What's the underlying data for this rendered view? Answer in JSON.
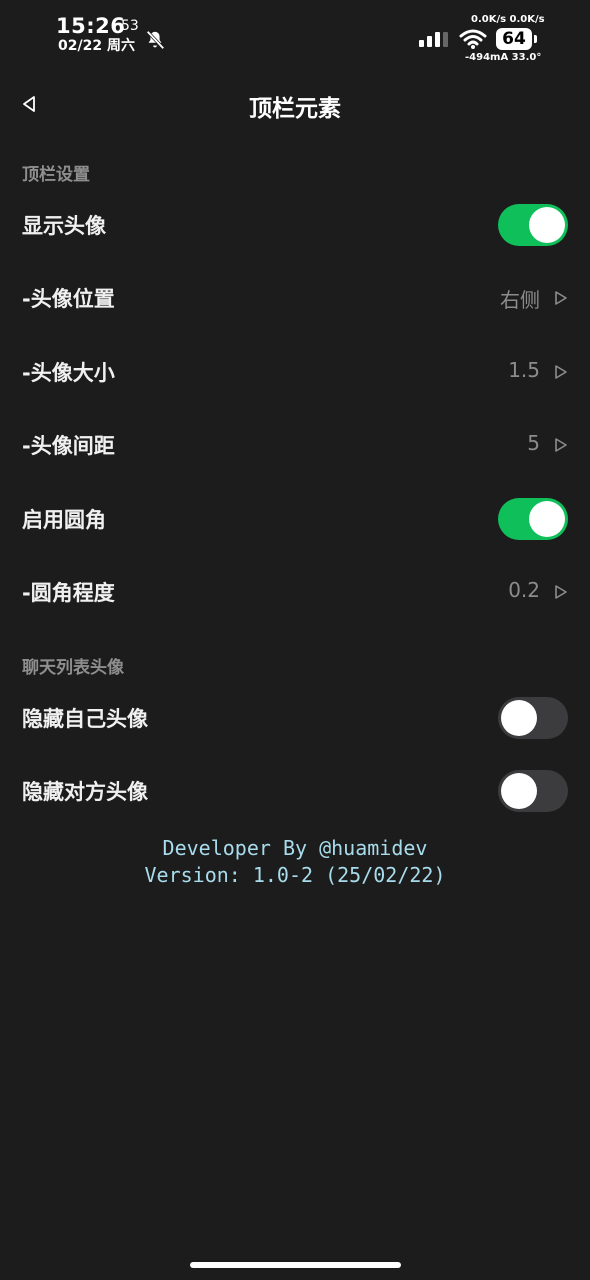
{
  "status_bar": {
    "time": "15:26",
    "seconds": "53",
    "date": "02/22 周六",
    "net_speed": "0.0K/s 0.0K/s",
    "battery": "64",
    "power": "-494mA 33.0°",
    "icons": [
      "bell-off-icon",
      "signal-icon",
      "wifi-icon",
      "battery-icon"
    ]
  },
  "header": {
    "title": "顶栏元素",
    "back_icon": "back-triangle-icon"
  },
  "sections": [
    {
      "title": "顶栏设置"
    },
    {
      "title": "聊天列表头像"
    }
  ],
  "rows": [
    {
      "label": "显示头像",
      "type": "toggle",
      "on": true
    },
    {
      "label": "-头像位置",
      "type": "value",
      "value": "右侧"
    },
    {
      "label": "-头像大小",
      "type": "value",
      "value": "1.5"
    },
    {
      "label": "-头像间距",
      "type": "value",
      "value": "5"
    },
    {
      "label": "启用圆角",
      "type": "toggle",
      "on": true
    },
    {
      "label": "-圆角程度",
      "type": "value",
      "value": "0.2"
    },
    {
      "label": "隐藏自己头像",
      "type": "toggle",
      "on": false
    },
    {
      "label": "隐藏对方头像",
      "type": "toggle",
      "on": false
    }
  ],
  "footer": {
    "developer": "Developer By @huamidev",
    "version": "Version: 1.0-2 (25/02/22)"
  },
  "colors": {
    "accent": "#0fc05a",
    "background": "#1c1c1c",
    "footer_text": "#a8dcec"
  }
}
